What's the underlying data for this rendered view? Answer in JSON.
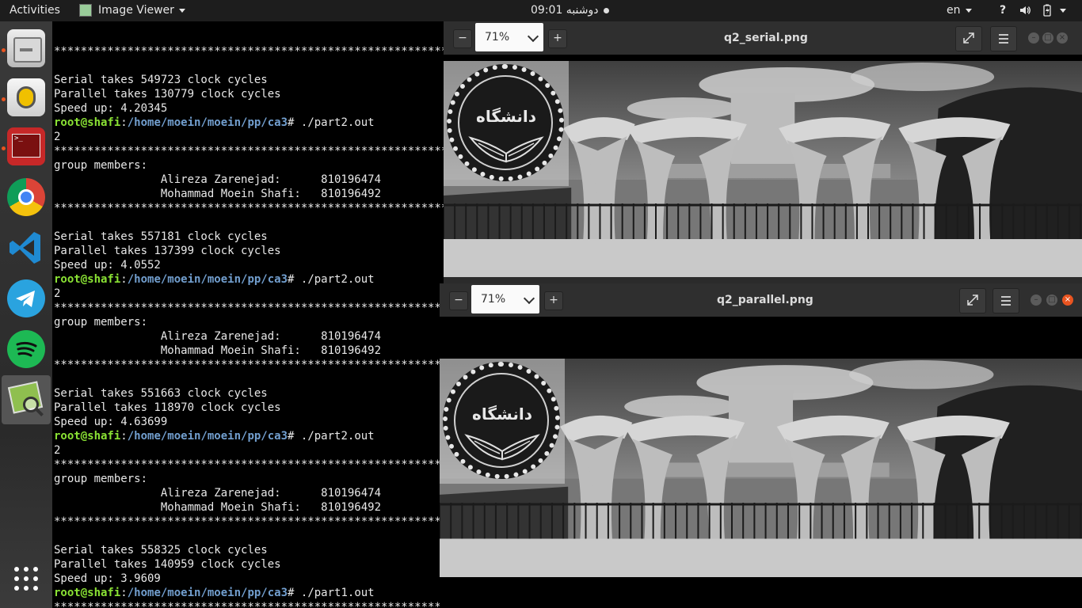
{
  "topbar": {
    "activities": "Activities",
    "app_menu": "Image Viewer",
    "clock": "دوشنبه 09:01",
    "language": "en"
  },
  "dock": {
    "icons": [
      "files-icon",
      "rhythmbox-icon",
      "terminal-icon",
      "chrome-icon",
      "vscode-icon",
      "telegram-icon",
      "spotify-icon",
      "image-viewer-icon",
      "show-apps-icon"
    ]
  },
  "terminal": {
    "lines": [
      {
        "text": "************************************************************"
      },
      {
        "text": ""
      },
      {
        "text": "Serial takes 549723 clock cycles"
      },
      {
        "text": "Parallel takes 130779 clock cycles"
      },
      {
        "text": "Speed up: 4.20345"
      },
      {
        "user": "root@shafi",
        "sep": ":",
        "path": "/home/moein/moein/pp/ca3",
        "cmd": "# ./part2.out"
      },
      {
        "text": "2"
      },
      {
        "text": "************************************************************"
      },
      {
        "text": "group members:"
      },
      {
        "text": "                Alireza Zarenejad:      810196474"
      },
      {
        "text": "                Mohammad Moein Shafi:   810196492"
      },
      {
        "text": "************************************************************"
      },
      {
        "text": ""
      },
      {
        "text": "Serial takes 557181 clock cycles"
      },
      {
        "text": "Parallel takes 137399 clock cycles"
      },
      {
        "text": "Speed up: 4.0552"
      },
      {
        "user": "root@shafi",
        "sep": ":",
        "path": "/home/moein/moein/pp/ca3",
        "cmd": "# ./part2.out"
      },
      {
        "text": "2"
      },
      {
        "text": "************************************************************"
      },
      {
        "text": "group members:"
      },
      {
        "text": "                Alireza Zarenejad:      810196474"
      },
      {
        "text": "                Mohammad Moein Shafi:   810196492"
      },
      {
        "text": "************************************************************"
      },
      {
        "text": ""
      },
      {
        "text": "Serial takes 551663 clock cycles"
      },
      {
        "text": "Parallel takes 118970 clock cycles"
      },
      {
        "text": "Speed up: 4.63699"
      },
      {
        "user": "root@shafi",
        "sep": ":",
        "path": "/home/moein/moein/pp/ca3",
        "cmd": "# ./part2.out"
      },
      {
        "text": "2"
      },
      {
        "text": "************************************************************"
      },
      {
        "text": "group members:"
      },
      {
        "text": "                Alireza Zarenejad:      810196474"
      },
      {
        "text": "                Mohammad Moein Shafi:   810196492"
      },
      {
        "text": "************************************************************"
      },
      {
        "text": ""
      },
      {
        "text": "Serial takes 558325 clock cycles"
      },
      {
        "text": "Parallel takes 140959 clock cycles"
      },
      {
        "text": "Speed up: 3.9609"
      },
      {
        "user": "root@shafi",
        "sep": ":",
        "path": "/home/moein/moein/pp/ca3",
        "cmd": "# ./part1.out"
      },
      {
        "text": "************************************************************"
      }
    ]
  },
  "viewer_serial": {
    "zoom": "71%",
    "title": "q2_serial.png",
    "logo_text": "دانشگاه"
  },
  "viewer_parallel": {
    "zoom": "71%",
    "title": "q2_parallel.png",
    "logo_text": "دانشگاه"
  },
  "colors": {
    "accent": "#e95420",
    "terminal_bg": "#000000",
    "prompt_user": "#8ae234",
    "prompt_path": "#729fcf"
  }
}
